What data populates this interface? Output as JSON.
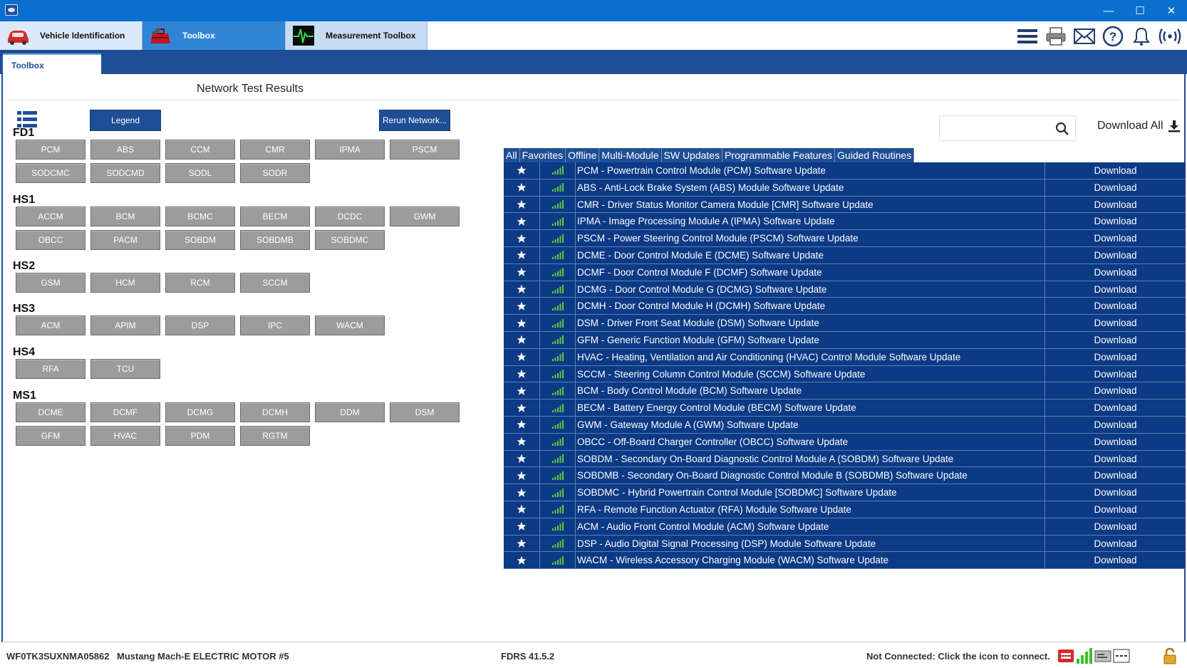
{
  "window": {
    "minimize": "—",
    "maximize": "☐",
    "close": "✕"
  },
  "main_tabs": [
    {
      "label": "Vehicle Identification",
      "icon": "car-icon"
    },
    {
      "label": "Toolbox",
      "icon": "toolbox-icon"
    },
    {
      "label": "Measurement Toolbox",
      "icon": "oscilloscope-icon"
    }
  ],
  "toolbar_icons": [
    "menu-icon",
    "printer-icon",
    "mail-icon",
    "help-icon",
    "bell-icon",
    "wireless-icon"
  ],
  "sub_tab": "Toolbox",
  "page_title": "Network Test Results",
  "buttons": {
    "legend": "Legend",
    "rerun": "Rerun Network..."
  },
  "networks": [
    {
      "name": "FD1",
      "modules": [
        "PCM",
        "ABS",
        "CCM",
        "CMR",
        "IPMA",
        "PSCM",
        "SODCMC",
        "SODCMD",
        "SODL",
        "SODR"
      ]
    },
    {
      "name": "HS1",
      "modules": [
        "ACCM",
        "BCM",
        "BCMC",
        "BECM",
        "DCDC",
        "GWM",
        "OBCC",
        "PACM",
        "SOBDM",
        "SOBDMB",
        "SOBDMC"
      ]
    },
    {
      "name": "HS2",
      "modules": [
        "GSM",
        "HCM",
        "RCM",
        "SCCM"
      ]
    },
    {
      "name": "HS3",
      "modules": [
        "ACM",
        "APIM",
        "DSP",
        "IPC",
        "WACM"
      ]
    },
    {
      "name": "HS4",
      "modules": [
        "RFA",
        "TCU"
      ]
    },
    {
      "name": "MS1",
      "modules": [
        "DCME",
        "DCMF",
        "DCMG",
        "DCMH",
        "DDM",
        "DSM",
        "GFM",
        "HVAC",
        "PDM",
        "RGTM"
      ]
    }
  ],
  "search": {
    "placeholder": ""
  },
  "download_all": "Download All",
  "filters": [
    "All",
    "Favorites",
    "Offline",
    "Multi-Module",
    "SW Updates",
    "Programmable Features",
    "Guided Routines"
  ],
  "download_label": "Download",
  "updates": [
    "PCM - Powertrain Control Module (PCM) Software Update",
    "ABS - Anti-Lock Brake System (ABS) Module Software Update",
    "CMR - Driver Status Monitor Camera Module [CMR] Software Update",
    "IPMA - Image Processing Module A (IPMA) Software Update",
    "PSCM - Power Steering Control Module (PSCM) Software Update",
    "DCME - Door Control Module E (DCME) Software Update",
    "DCMF - Door Control Module F (DCMF) Software Update",
    "DCMG - Door Control Module G (DCMG) Software Update",
    "DCMH - Door Control Module H (DCMH) Software Update",
    "DSM - Driver Front Seat Module (DSM) Software Update",
    "GFM - Generic Function Module (GFM) Software Update",
    "HVAC - Heating, Ventilation and Air Conditioning (HVAC) Control Module Software Update",
    "SCCM - Steering Column Control Module (SCCM) Software Update",
    "BCM - Body Control Module (BCM) Software Update",
    "BECM - Battery Energy Control Module (BECM) Software Update",
    "GWM - Gateway Module A (GWM) Software Update",
    "OBCC - Off-Board Charger Controller (OBCC) Software Update",
    "SOBDM - Secondary On-Board Diagnostic Control Module A (SOBDM) Software Update",
    "SOBDMB - Secondary On-Board Diagnostic Control Module B (SOBDMB) Software Update",
    "SOBDMC - Hybrid Powertrain Control Module [SOBDMC] Software Update",
    "RFA - Remote Function Actuator (RFA) Module Software Update",
    "ACM - Audio Front Control Module (ACM) Software Update",
    "DSP - Audio Digital Signal Processing (DSP) Module Software Update",
    "WACM - Wireless Accessory Charging Module (WACM) Software Update"
  ],
  "status": {
    "vin": "WF0TK3SUXNMA05862",
    "vehicle": "Mustang Mach-E ELECTRIC MOTOR #5",
    "version": "FDRS 41.5.2",
    "connection": "Not Connected: Click the icon to connect.",
    "icons": [
      "vci-red-icon",
      "signal-bars-icon",
      "network-card-icon",
      "dashes-icon",
      "lock-icon"
    ]
  },
  "colors": {
    "accent": "#1f4e96",
    "title_bar": "#0a6fcf",
    "table_bg": "#0d3a85",
    "module_button": "#9c9c9c",
    "signal_green": "#5ec83a"
  }
}
